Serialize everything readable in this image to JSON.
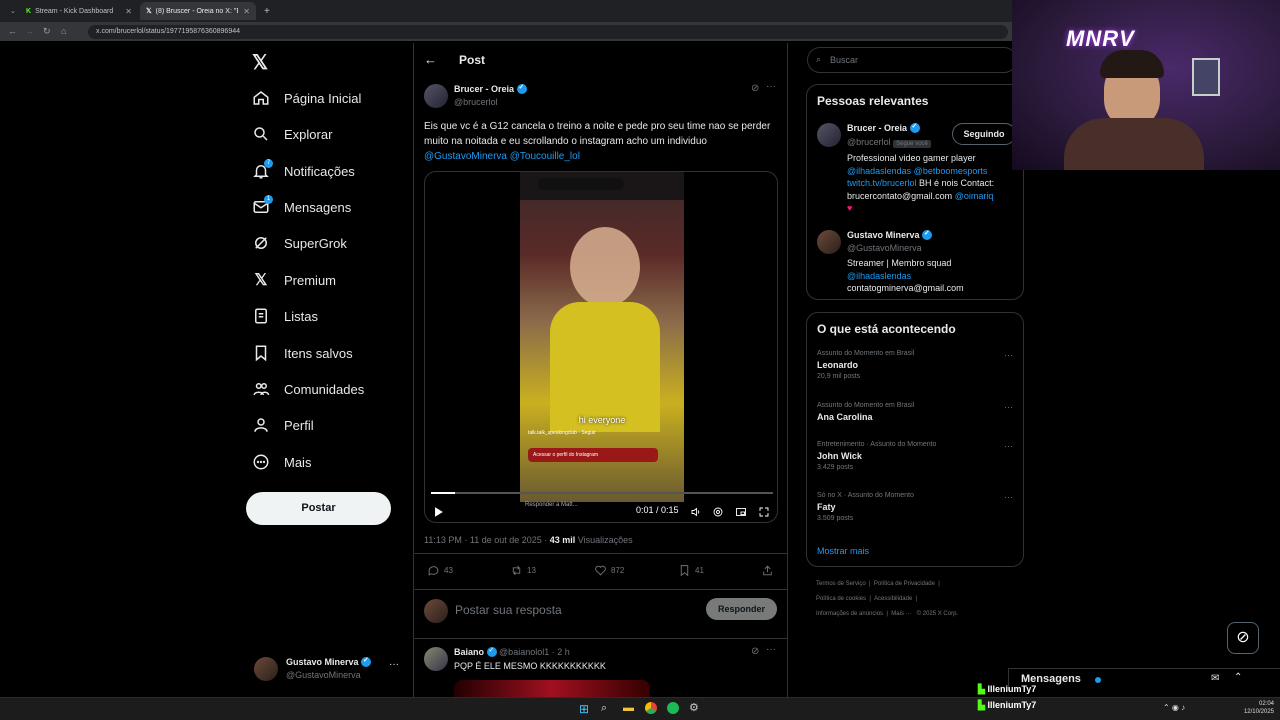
{
  "browser": {
    "tabs": [
      {
        "title": "Stream - Kick Dashboard",
        "icon": "kick-icon"
      },
      {
        "title": "(8) Bruscer - Oreia no X: \"Eis que...",
        "icon": "x-icon"
      }
    ],
    "url": "x.com/brucerlol/status/1977195876360896944"
  },
  "nav": {
    "items": [
      {
        "label": "Página Inicial",
        "icon": "home-icon"
      },
      {
        "label": "Explorar",
        "icon": "search-icon"
      },
      {
        "label": "Notificações",
        "icon": "bell-icon",
        "badge": "7"
      },
      {
        "label": "Mensagens",
        "icon": "mail-icon",
        "badge": "1"
      },
      {
        "label": "SuperGrok",
        "icon": "grok-icon"
      },
      {
        "label": "Premium",
        "icon": "x-icon"
      },
      {
        "label": "Listas",
        "icon": "list-icon"
      },
      {
        "label": "Itens salvos",
        "icon": "bookmark-icon"
      },
      {
        "label": "Comunidades",
        "icon": "people-icon"
      },
      {
        "label": "Perfil",
        "icon": "person-icon"
      },
      {
        "label": "Mais",
        "icon": "more-circle-icon"
      }
    ],
    "post_button": "Postar",
    "account": {
      "name": "Gustavo Minerva",
      "handle": "@GustavoMinerva"
    }
  },
  "post": {
    "header_title": "Post",
    "author": {
      "name": "Brucer - Oreia",
      "handle": "@brucerlol"
    },
    "text": "Eis que vc é a G12 cancela o treino a noite e pede pro seu time nao se perder muito na noitada e eu scrollando o instagram acho um individuo",
    "mentions": "@GustavoMinerva @Toucouille_lol",
    "video": {
      "caption": "hi everyone",
      "account_tag": "talk.talk_speakingclub",
      "follow_label": "Seguir",
      "profile_button": "Acessar o perfil do Instagram",
      "reply_placeholder": "Responder a Matt...",
      "time": "0:01 / 0:15",
      "progress": 0.07
    },
    "timestamp": "11:13 PM · 11 de out de 2025",
    "views_count": "43 mil",
    "views_label": "Visualizações",
    "stats": {
      "replies": "43",
      "reposts": "13",
      "likes": "872",
      "bookmarks": "41"
    },
    "reply_placeholder": "Postar sua resposta",
    "reply_button": "Responder"
  },
  "reply": {
    "name": "Baiano",
    "handle": "@baianolol1 · 2 h",
    "text": "PQP É ELE MESMO KKKKKKKKKKK"
  },
  "sidebar": {
    "search_placeholder": "Buscar",
    "relevant_title": "Pessoas relevantes",
    "people": [
      {
        "name": "Brucer - Oreia",
        "handle": "@brucerlol",
        "follows_you": "Segue você",
        "button": "Seguindo",
        "bio_line1": "Professional video gamer player",
        "bio_links1": "@ilhadaslendas @betboomesports",
        "bio_line2_link": "twitch.tv/brucerlol",
        "bio_line2": " BH é nois Contact:",
        "bio_line3": "brucercontato@gmail.com ",
        "bio_line3_link": "@oimariq"
      },
      {
        "name": "Gustavo Minerva",
        "handle": "@GustavoMinerva",
        "bio_line1": "Streamer | Membro squad",
        "bio_link": "@ilhadaslendas",
        "bio_line3": "contatogminerva@gmail.com"
      }
    ],
    "trends_title": "O que está acontecendo",
    "trends": [
      {
        "category": "Assunto do Momento em Brasil",
        "name": "Leonardo",
        "count": "20,9 mil posts"
      },
      {
        "category": "Assunto do Momento em Brasil",
        "name": "Ana Carolina",
        "count": ""
      },
      {
        "category": "Entretenimento · Assunto do Momento",
        "name": "John Wick",
        "count": "3.429 posts"
      },
      {
        "category": "Só no X · Assunto do Momento",
        "name": "Faty",
        "count": "3.509 posts"
      }
    ],
    "show_more": "Mostrar mais",
    "footer": [
      "Termos de Serviço",
      "Política de Privacidade",
      "Política de cookies",
      "Acessibilidade",
      "Informações de anúncios",
      "Mais ···",
      "© 2025 X Corp."
    ]
  },
  "overlay": {
    "cam_logo": "MNRV",
    "messages_label": "Mensagens",
    "chat": [
      {
        "user": "IlleniumTy7"
      },
      {
        "user": "IlleniumTy7"
      }
    ]
  },
  "taskbar": {
    "time": "02:04",
    "date": "12/10/2025"
  }
}
